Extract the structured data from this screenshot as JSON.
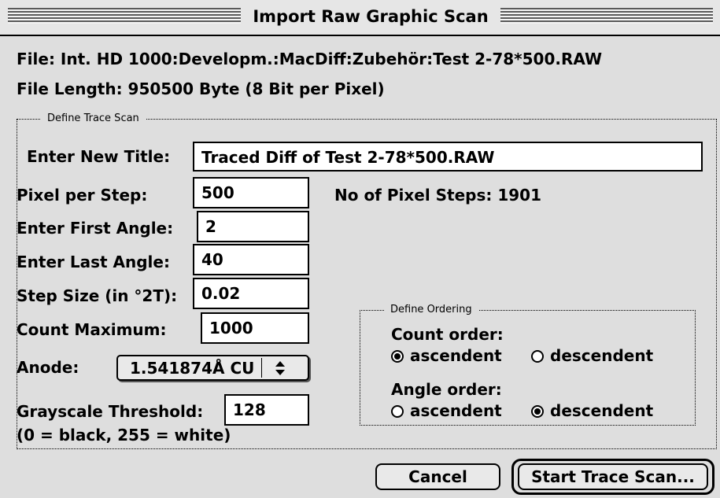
{
  "window": {
    "title": "Import Raw Graphic Scan"
  },
  "file": {
    "path_label": "File: Int. HD 1000:Developm.:MacDiff:Zubehör:Test 2-78*500.RAW",
    "length_label": "File Length: 950500 Byte (8 Bit per Pixel)"
  },
  "trace_group": {
    "title": "Define Trace Scan",
    "new_title_label": "Enter New Title:",
    "new_title_value": "Traced Diff of Test 2-78*500.RAW",
    "pixel_per_step_label": "Pixel per Step:",
    "pixel_per_step_value": "500",
    "pixel_steps_label": "No of Pixel Steps: 1901",
    "first_angle_label": "Enter First Angle:",
    "first_angle_value": "2",
    "last_angle_label": "Enter Last Angle:",
    "last_angle_value": "40",
    "step_size_label": "Step Size (in °2T):",
    "step_size_value": "0.02",
    "count_max_label": "Count Maximum:",
    "count_max_value": "1000",
    "anode_label": "Anode:",
    "anode_value": "1.541874Å CU",
    "threshold_label": "Grayscale Threshold:",
    "threshold_value": "128",
    "threshold_hint": "(0 = black, 255 = white)"
  },
  "ordering_group": {
    "title": "Define Ordering",
    "count_order_label": "Count order:",
    "angle_order_label": "Angle order:",
    "ascendent_label": "ascendent",
    "descendent_label": "descendent",
    "count_order_selected": "ascendent",
    "angle_order_selected": "descendent"
  },
  "buttons": {
    "cancel": "Cancel",
    "start": "Start Trace Scan..."
  },
  "icons": {
    "popup_arrows": "up-down-arrows-icon",
    "radio": "radio-button-icon"
  }
}
